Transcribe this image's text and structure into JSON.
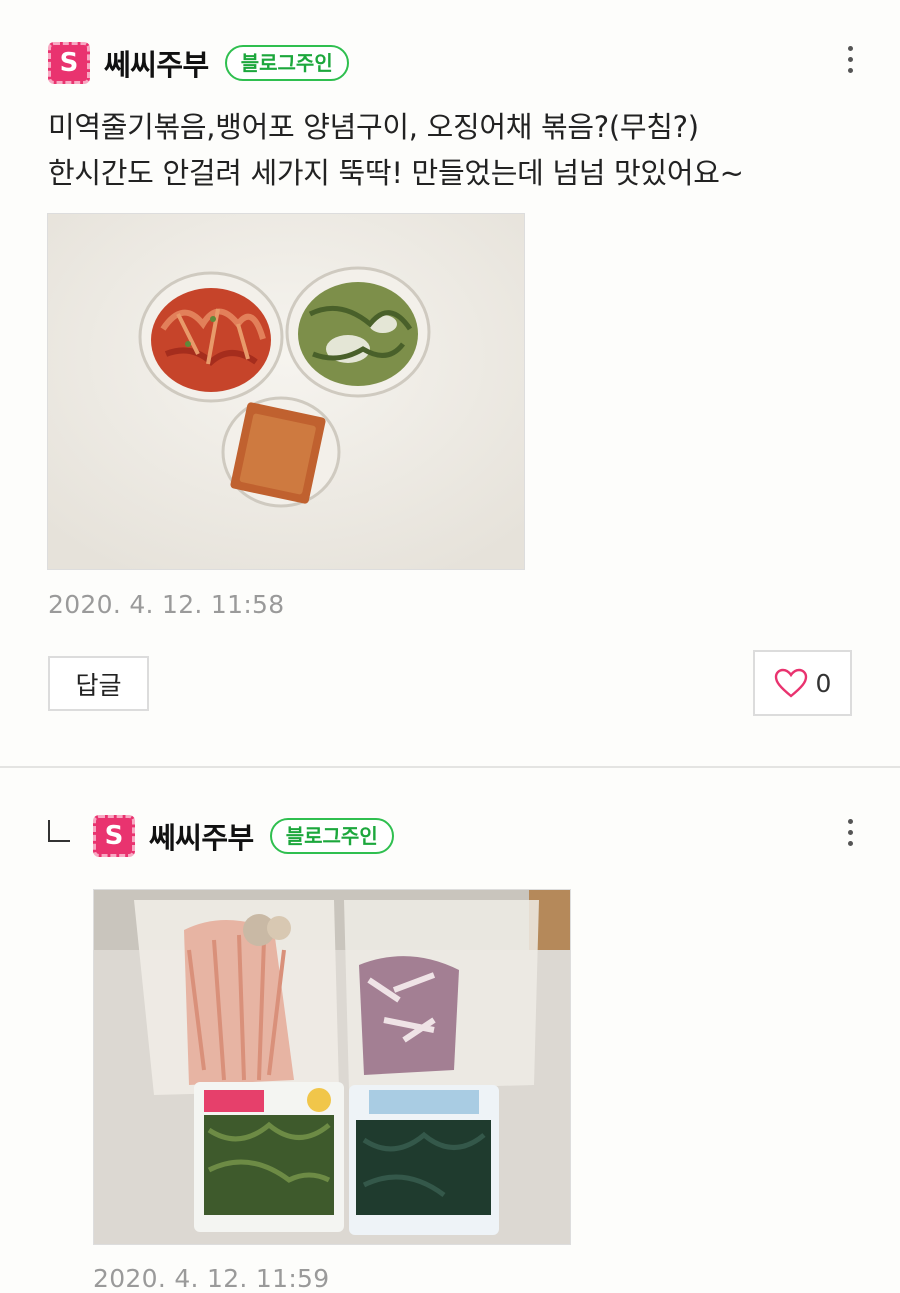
{
  "comments": [
    {
      "avatar_letter": "S",
      "nickname": "쎄씨주부",
      "badge": "블로그주인",
      "text": "미역줄기볶음,뱅어포 양념구이, 오징어채 볶음?(무침?)\n한시간도 안걸려 세가지 뚝딱! 만들었는데 넘넘 맛있어요~",
      "date": "2020. 4. 12. 11:58",
      "reply_label": "답글",
      "like_count": "0"
    },
    {
      "avatar_letter": "S",
      "nickname": "쎄씨주부",
      "badge": "블로그주인",
      "date": "2020. 4. 12. 11:59"
    }
  ],
  "colors": {
    "avatar": "#e9336f",
    "badge_green": "#2fbf4f",
    "like_heart": "#e9336f"
  },
  "icons": {
    "more": "more-vertical-icon",
    "like": "heart-outline-icon",
    "reply_marker": "reply-arrow-icon"
  }
}
